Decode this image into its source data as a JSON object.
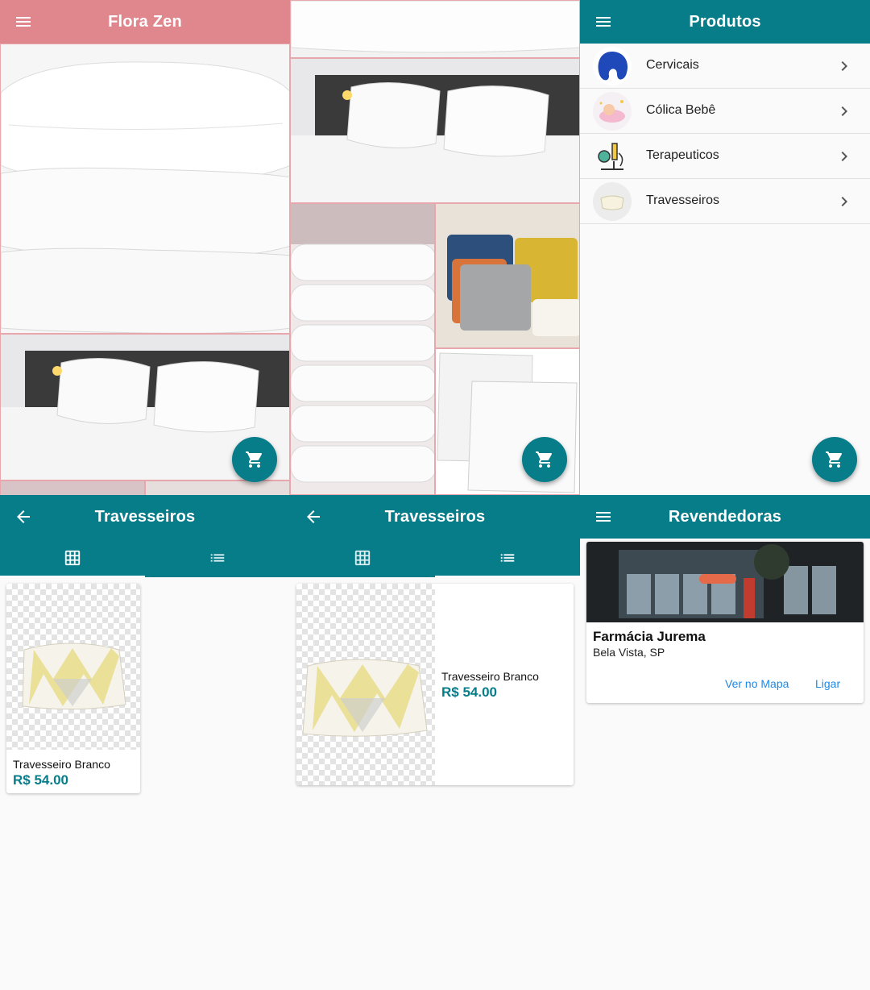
{
  "colors": {
    "teal": "#087d8a",
    "pink": "#df878d",
    "link": "#1e88e5"
  },
  "screen1": {
    "title": "Flora Zen",
    "menu_icon": "menu-icon",
    "cart_icon": "cart-icon"
  },
  "screen3": {
    "title": "Produtos",
    "items": [
      {
        "label": "Cervicais",
        "icon": "neck-pillow-icon"
      },
      {
        "label": "Cólica Bebê",
        "icon": "baby-icon"
      },
      {
        "label": "Terapeuticos",
        "icon": "microscope-icon"
      },
      {
        "label": "Travesseiros",
        "icon": "pillow-icon"
      }
    ]
  },
  "screen4": {
    "title": "Travesseiros",
    "tabs": [
      "grid-icon",
      "list-icon"
    ],
    "product": {
      "name": "Travesseiro Branco",
      "price": "R$ 54.00"
    }
  },
  "screen5": {
    "title": "Travesseiros",
    "product": {
      "name": "Travesseiro Branco",
      "price": "R$ 54.00"
    }
  },
  "screen6": {
    "title": "Revendedoras",
    "store": {
      "name": "Farmácia Jurema",
      "location": "Bela Vista, SP",
      "map_label": "Ver no Mapa",
      "call_label": "Ligar"
    }
  }
}
